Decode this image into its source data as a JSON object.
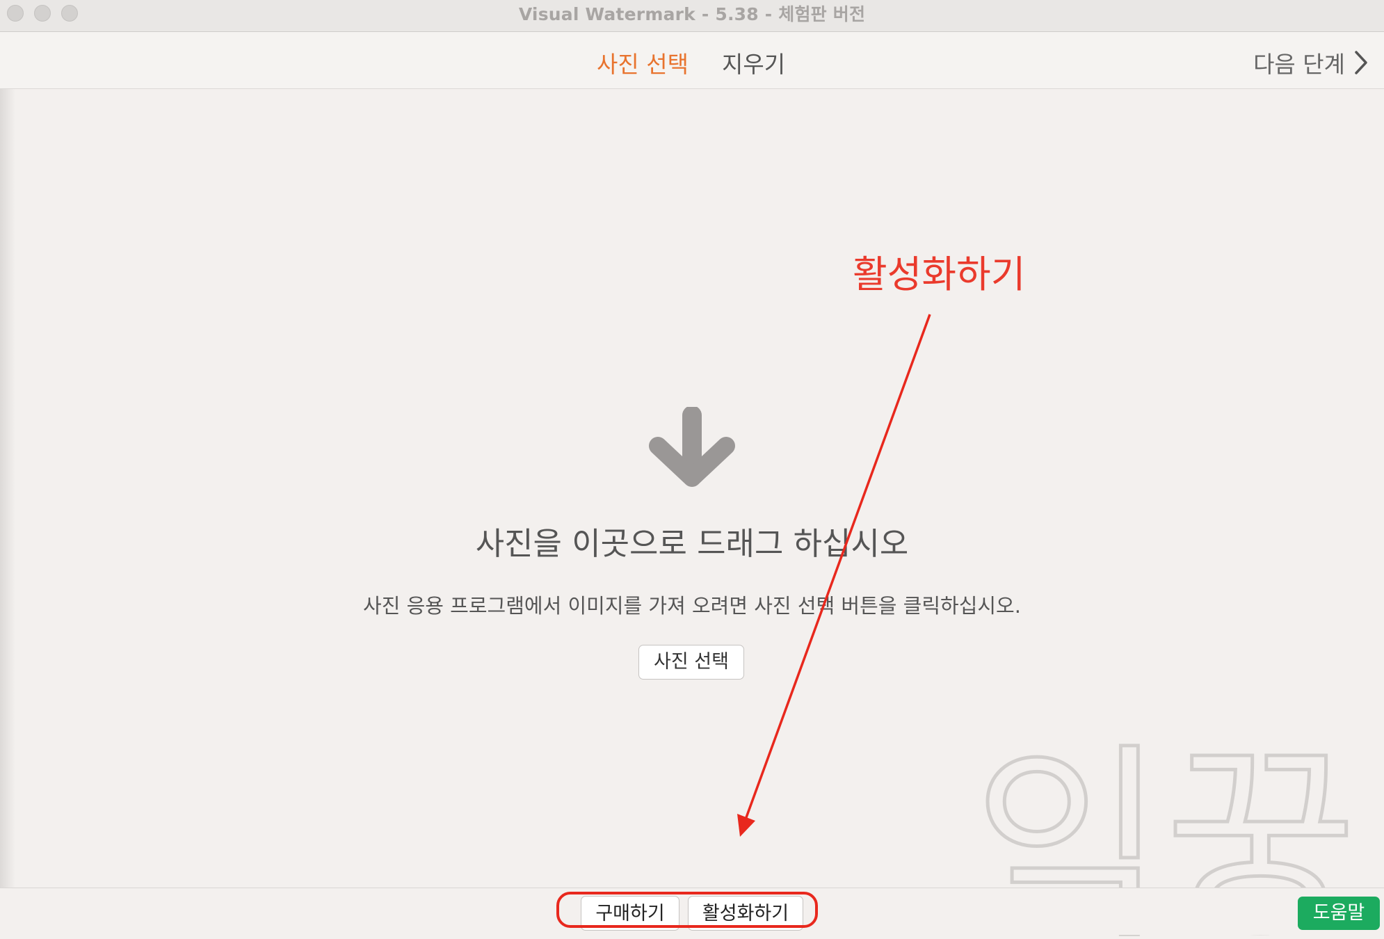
{
  "window": {
    "title": "Visual Watermark - 5.38 - 체험판 버전"
  },
  "toolbar": {
    "tabs": [
      {
        "label": "사진 선택",
        "active": true
      },
      {
        "label": "지우기",
        "active": false
      }
    ],
    "next_step": "다음 단계",
    "active_color": "#e8732e"
  },
  "drop_zone": {
    "icon": "arrow-down-icon",
    "title": "사진을 이곳으로 드래그 하십시오",
    "description": "사진 응용 프로그램에서 이미지를 가져 오려면 사진 선택 버튼을 클릭하십시오.",
    "select_button": "사진 선택"
  },
  "watermark": {
    "text": "익꿍"
  },
  "annotation": {
    "label": "활성화하기",
    "color": "#ea3a2c"
  },
  "bottom_bar": {
    "buy_button": "구매하기",
    "activate_button": "활성화하기",
    "help_button": "도움말",
    "help_color": "#1cab5f"
  }
}
